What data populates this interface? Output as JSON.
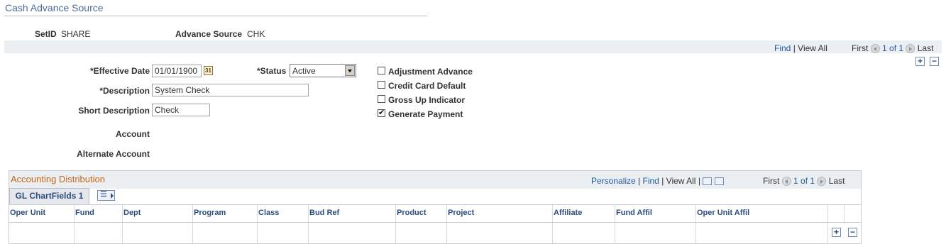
{
  "page": {
    "title": "Cash Advance Source"
  },
  "header_fields": {
    "setid_label": "SetID",
    "setid_value": "SHARE",
    "source_label": "Advance Source",
    "source_value": "CHK"
  },
  "nav_bar": {
    "find": "Find",
    "sep": "|",
    "view_all": "View All",
    "first": "First",
    "count": "1 of 1",
    "last": "Last"
  },
  "form": {
    "effective_date_label": "*Effective Date",
    "effective_date_value": "01/01/1900",
    "status_label": "*Status",
    "status_value": "Active",
    "description_label": "*Description",
    "description_value": "System Check",
    "short_description_label": "Short Description",
    "short_description_value": "Check",
    "account_label": "Account",
    "alternate_account_label": "Alternate Account"
  },
  "checkboxes": [
    {
      "label": "Adjustment Advance",
      "checked": false
    },
    {
      "label": "Credit Card Default",
      "checked": false
    },
    {
      "label": "Gross Up Indicator",
      "checked": false
    },
    {
      "label": "Generate Payment",
      "checked": true
    }
  ],
  "grid": {
    "title": "Accounting Distribution",
    "personalize": "Personalize",
    "find": "Find",
    "view_all": "View All",
    "first": "First",
    "count": "1 of 1",
    "last": "Last",
    "tab_label": "GL ChartFields 1",
    "columns": [
      "Oper Unit",
      "Fund",
      "Dept",
      "Program",
      "Class",
      "Bud Ref",
      "Product",
      "Project",
      "Affiliate",
      "Fund Affil",
      "Oper Unit Affil"
    ]
  },
  "buttons": {
    "add": "+",
    "remove": "−"
  },
  "colors": {
    "title": "#4a6c97",
    "grid_title": "#c2661c",
    "link": "#1f5a9e",
    "bar_bg": "#eceff1"
  }
}
